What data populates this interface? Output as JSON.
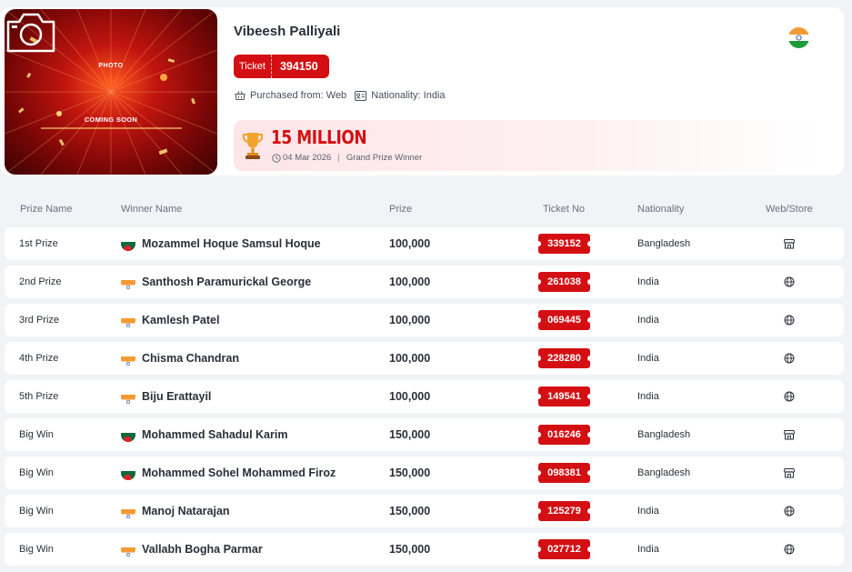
{
  "winner": {
    "photo_top": "PHOTO",
    "photo_bottom": "COMING SOON",
    "name": "Vibeesh Palliyali",
    "flag": "india-flag-icon",
    "ticket_label": "Ticket",
    "ticket_number": "394150",
    "purchased_from": "Purchased from: Web",
    "nationality": "Nationality: India",
    "prize": "15 MILLION",
    "date": "04 Mar 2026",
    "prize_type": "Grand Prize Winner"
  },
  "table": {
    "headers": {
      "prize_name": "Prize Name",
      "winner_name": "Winner Name",
      "prize": "Prize",
      "ticket_no": "Ticket No",
      "nationality": "Nationality",
      "channel": "Web/Store"
    },
    "rows": [
      {
        "prize_name": "1st Prize",
        "flag": "bangladesh",
        "winner": "Mozammel Hoque Samsul Hoque",
        "prize": "100,000",
        "ticket": "339152",
        "nationality": "Bangladesh",
        "channel": "store-icon"
      },
      {
        "prize_name": "2nd Prize",
        "flag": "india",
        "winner": "Santhosh Paramurickal George",
        "prize": "100,000",
        "ticket": "261038",
        "nationality": "India",
        "channel": "globe-icon"
      },
      {
        "prize_name": "3rd Prize",
        "flag": "india",
        "winner": "Kamlesh Patel",
        "prize": "100,000",
        "ticket": "069445",
        "nationality": "India",
        "channel": "globe-icon"
      },
      {
        "prize_name": "4th Prize",
        "flag": "india",
        "winner": "Chisma Chandran",
        "prize": "100,000",
        "ticket": "228280",
        "nationality": "India",
        "channel": "globe-icon"
      },
      {
        "prize_name": "5th Prize",
        "flag": "india",
        "winner": "Biju Erattayil",
        "prize": "100,000",
        "ticket": "149541",
        "nationality": "India",
        "channel": "globe-icon"
      },
      {
        "prize_name": "Big Win",
        "flag": "bangladesh",
        "winner": "Mohammed Sahadul Karim",
        "prize": "150,000",
        "ticket": "016246",
        "nationality": "Bangladesh",
        "channel": "store-icon"
      },
      {
        "prize_name": "Big Win",
        "flag": "bangladesh",
        "winner": "Mohammed Sohel Mohammed Firoz",
        "prize": "150,000",
        "ticket": "098381",
        "nationality": "Bangladesh",
        "channel": "store-icon"
      },
      {
        "prize_name": "Big Win",
        "flag": "india",
        "winner": "Manoj Natarajan",
        "prize": "150,000",
        "ticket": "125279",
        "nationality": "India",
        "channel": "globe-icon"
      },
      {
        "prize_name": "Big Win",
        "flag": "india",
        "winner": "Vallabh Bogha Parmar",
        "prize": "150,000",
        "ticket": "027712",
        "nationality": "India",
        "channel": "globe-icon"
      }
    ]
  },
  "colors": {
    "accent": "#d40f13",
    "background": "#f2f3f7",
    "card": "#ffffff"
  }
}
